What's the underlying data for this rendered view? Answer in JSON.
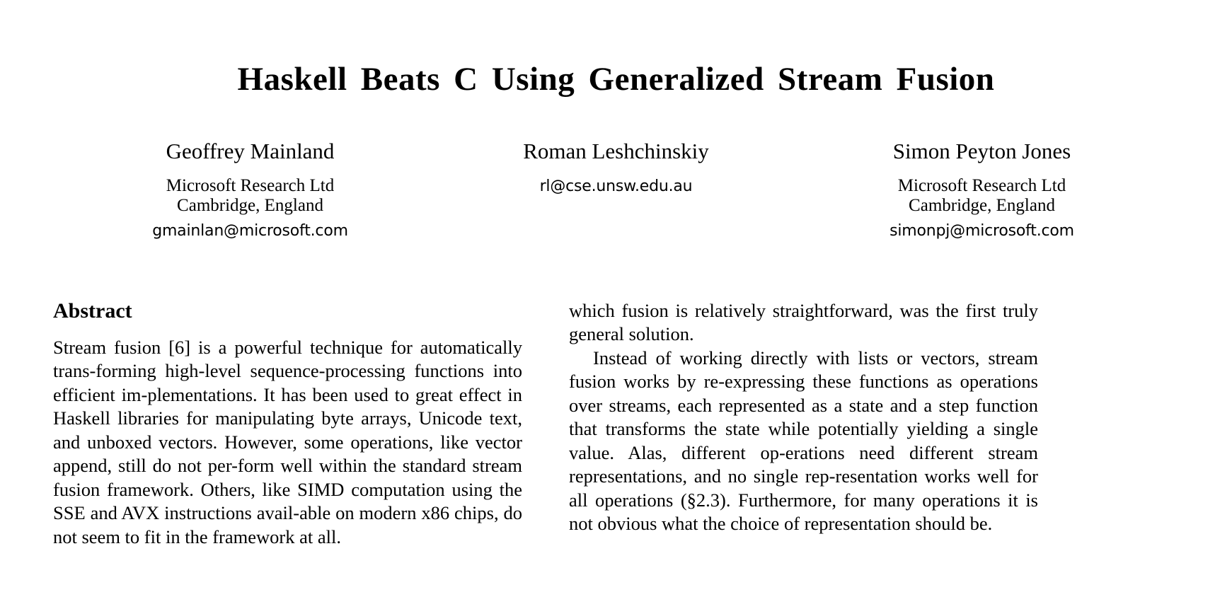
{
  "paper": {
    "title": "Haskell Beats C Using Generalized Stream Fusion",
    "authors": [
      {
        "name": "Geoffrey Mainland",
        "affiliation_line1": "Microsoft Research Ltd",
        "affiliation_line2": "Cambridge, England",
        "email": "gmainlan@microsoft.com"
      },
      {
        "name": "Roman Leshchinskiy",
        "affiliation_line1": "",
        "affiliation_line2": "",
        "email": "rl@cse.unsw.edu.au"
      },
      {
        "name": "Simon Peyton Jones",
        "affiliation_line1": "Microsoft Research Ltd",
        "affiliation_line2": "Cambridge, England",
        "email": "simonpj@microsoft.com"
      }
    ],
    "left_column": {
      "heading": "Abstract",
      "paragraph": "Stream fusion [6] is a powerful technique for automatically trans-forming high-level sequence-processing functions into efficient im-plementations. It has been used to great effect in Haskell libraries for manipulating byte arrays, Unicode text, and unboxed vectors. However, some operations, like vector append, still do not per-form well within the standard stream fusion framework. Others, like SIMD computation using the SSE and AVX instructions avail-able on modern x86 chips, do not seem to fit in the framework at all."
    },
    "right_column": {
      "paragraph_continued": "which fusion is relatively straightforward, was the first truly general solution.",
      "paragraph_2": "Instead of working directly with lists or vectors, stream fusion works by re-expressing these functions as operations over streams, each represented as a state and a step function that transforms the state while potentially yielding a single value. Alas, different op-erations need different stream representations, and no single rep-resentation works well for all operations (§2.3). Furthermore, for many operations it is not obvious what the choice of representation should be."
    }
  }
}
